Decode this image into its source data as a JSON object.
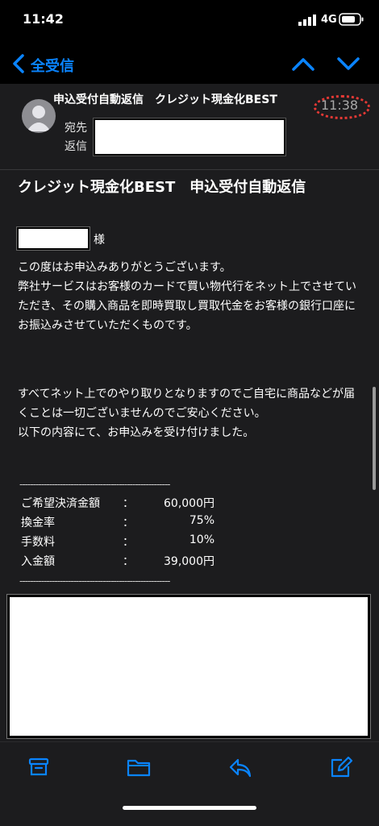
{
  "status": {
    "time": "11:42",
    "network": "4G"
  },
  "nav": {
    "back_label": "全受信"
  },
  "email": {
    "subject": "申込受付自動返信　クレジット現金化BEST",
    "time": "11:38",
    "to_label": "宛先",
    "reply_label": "返信",
    "title": "クレジット現金化BEST　申込受付自動返信",
    "honorific": "様",
    "paragraph1": "この度はお申込みありがとうございます。\n弊社サービスはお客様のカードで買い物代行をネット上でさせていただき、その購入商品を即時買取し買取代金をお客様の銀行口座にお振込みさせていただくものです。",
    "paragraph2": "すべてネット上でのやり取りとなりますのでご自宅に商品などが届くことは一切ございませんのでご安心ください。\n以下の内容にて、お申込みを受け付けました。",
    "divider": "--------------------------------------------------------",
    "fees": [
      {
        "label": "ご希望決済金額",
        "colon": "：",
        "value": "60,000円"
      },
      {
        "label": "換金率",
        "colon": "：",
        "value": "75%"
      },
      {
        "label": "手数料",
        "colon": "：",
        "value": "10%"
      },
      {
        "label": "入金額",
        "colon": "：",
        "value": "39,000円"
      }
    ]
  },
  "colors": {
    "accent": "#0a84ff",
    "background": "#1c1c1e",
    "highlight": "#e53935"
  },
  "icons": [
    "chevron-left-icon",
    "chevron-up-icon",
    "chevron-down-icon",
    "archive-icon",
    "folder-icon",
    "reply-icon",
    "compose-icon"
  ]
}
